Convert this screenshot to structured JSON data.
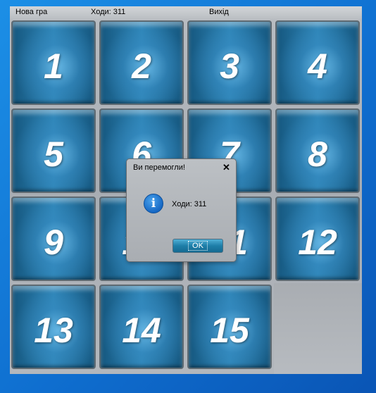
{
  "menu": {
    "new_game": "Нова гра",
    "moves": "Ходи: 311",
    "exit": "Вихід"
  },
  "board": {
    "tiles": [
      "1",
      "2",
      "3",
      "4",
      "5",
      "6",
      "7",
      "8",
      "9",
      "10",
      "11",
      "12",
      "13",
      "14",
      "15"
    ]
  },
  "dialog": {
    "title": "Ви перемогли!",
    "close": "✕",
    "icon": "info-icon",
    "message": "Ходи: 311",
    "ok_label": "OK"
  }
}
